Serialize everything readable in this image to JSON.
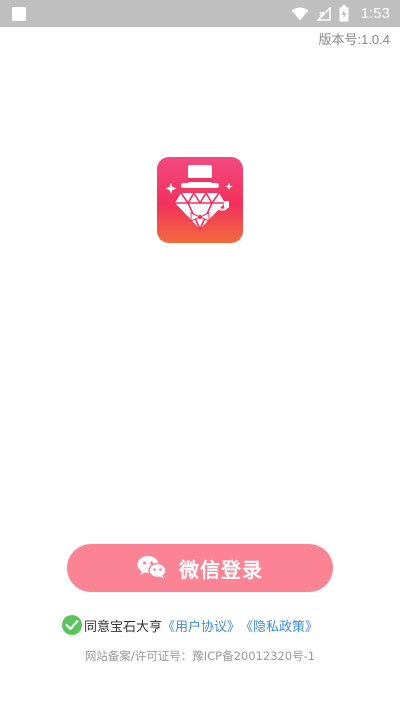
{
  "status_bar": {
    "time": "1:53",
    "icons": [
      "wifi-icon",
      "no-signal-icon",
      "battery-charging-icon"
    ]
  },
  "version_text": "版本号:1.0.4",
  "logo": {
    "icon": "diamond-gentleman-logo",
    "colors": [
      "#f24a82",
      "#f2315c",
      "#f36a3c"
    ]
  },
  "login_button": {
    "label": "微信登录",
    "icon": "wechat-icon",
    "color": "#fb8393"
  },
  "agreement": {
    "checked": true,
    "prefix": "同意宝石大亨",
    "user_agreement": "《用户协议》",
    "privacy_policy": "《隐私政策》"
  },
  "icp_text": "网站备案/许可证号：豫ICP备20012320号-1",
  "colors": {
    "accent": "#fb8393",
    "link": "#3b8ee6",
    "check": "#5ac45c",
    "status_bar": "#bfbfbf"
  }
}
